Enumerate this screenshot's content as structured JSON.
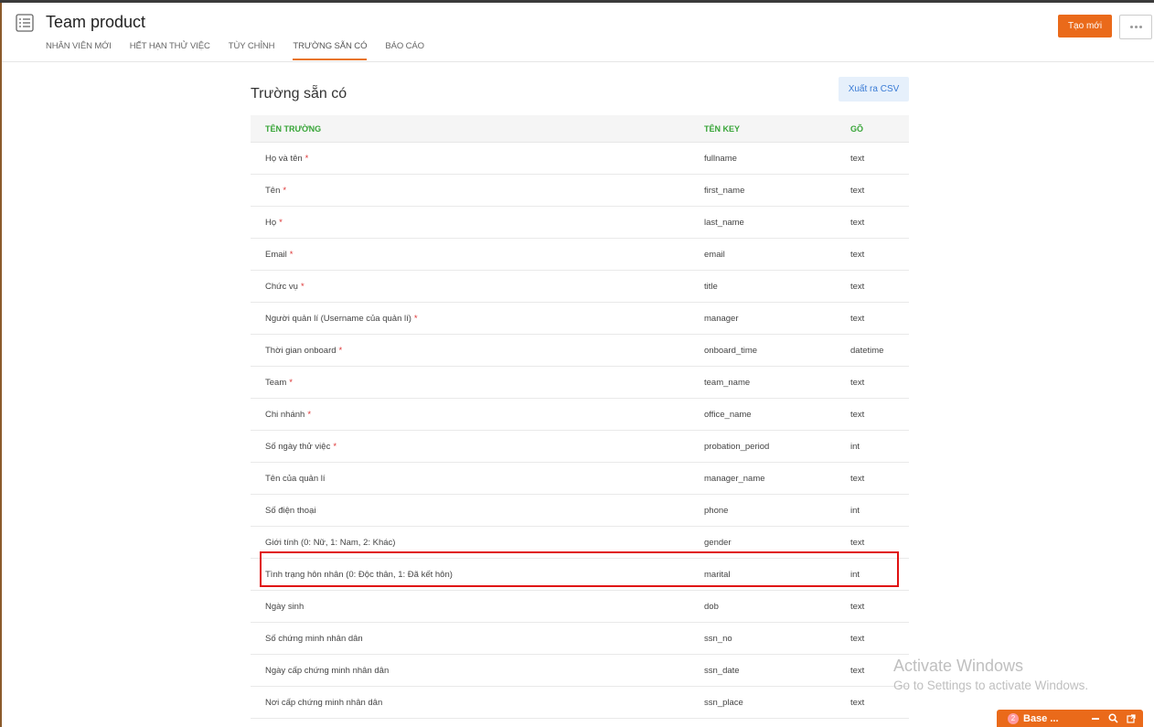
{
  "header": {
    "title": "Team product",
    "tabs": [
      {
        "label": "NHÂN VIÊN MỚI"
      },
      {
        "label": "HẾT HẠN THỬ VIỆC"
      },
      {
        "label": "TÙY CHỈNH"
      },
      {
        "label": "TRƯỜNG SẴN CÓ",
        "active": true
      },
      {
        "label": "BÁO CÁO"
      }
    ],
    "create_button": "Tạo mới",
    "accent": "#ea6a1a"
  },
  "main": {
    "title": "Trường sẵn có",
    "export_button": "Xuất ra CSV",
    "columns": {
      "name": "TÊN TRƯỜNG",
      "key": "TÊN KEY",
      "type": "GÕ"
    },
    "rows": [
      {
        "name": "Họ và tên",
        "required": "*",
        "key": "fullname",
        "type": "text"
      },
      {
        "name": "Tên",
        "required": "*",
        "key": "first_name",
        "type": "text"
      },
      {
        "name": "Họ",
        "required": "*",
        "key": "last_name",
        "type": "text"
      },
      {
        "name": "Email",
        "required": "*",
        "key": "email",
        "type": "text"
      },
      {
        "name": "Chức vụ",
        "required": "*",
        "key": "title",
        "type": "text"
      },
      {
        "name": "Người quản lí (Username của quản lí)",
        "required": "*",
        "key": "manager",
        "type": "text"
      },
      {
        "name": "Thời gian onboard",
        "required": "*",
        "key": "onboard_time",
        "type": "datetime"
      },
      {
        "name": "Team",
        "required": "*",
        "key": "team_name",
        "type": "text"
      },
      {
        "name": "Chi nhánh",
        "required": "*",
        "key": "office_name",
        "type": "text"
      },
      {
        "name": "Số ngày thử việc",
        "required": "*",
        "key": "probation_period",
        "type": "int"
      },
      {
        "name": "Tên của quản lí",
        "required": "",
        "key": "manager_name",
        "type": "text"
      },
      {
        "name": "Số điện thoại",
        "required": "",
        "key": "phone",
        "type": "int"
      },
      {
        "name": "Giới tính (0: Nữ, 1: Nam, 2: Khác)",
        "required": "",
        "key": "gender",
        "type": "text"
      },
      {
        "name": "Tình trạng hôn nhân (0: Độc thân, 1: Đã kết hôn)",
        "required": "",
        "key": "marital",
        "type": "int"
      },
      {
        "name": "Ngày sinh",
        "required": "",
        "key": "dob",
        "type": "text"
      },
      {
        "name": "Số chứng minh nhân dân",
        "required": "",
        "key": "ssn_no",
        "type": "text"
      },
      {
        "name": "Ngày cấp chứng minh nhân dân",
        "required": "",
        "key": "ssn_date",
        "type": "text"
      },
      {
        "name": "Nơi cấp chứng minh nhân dân",
        "required": "",
        "key": "ssn_place",
        "type": "text"
      }
    ]
  },
  "watermark": {
    "line1": "Activate Windows",
    "line2": "Go to Settings to activate Windows."
  },
  "chat": {
    "count": "2",
    "label": "Base ..."
  }
}
